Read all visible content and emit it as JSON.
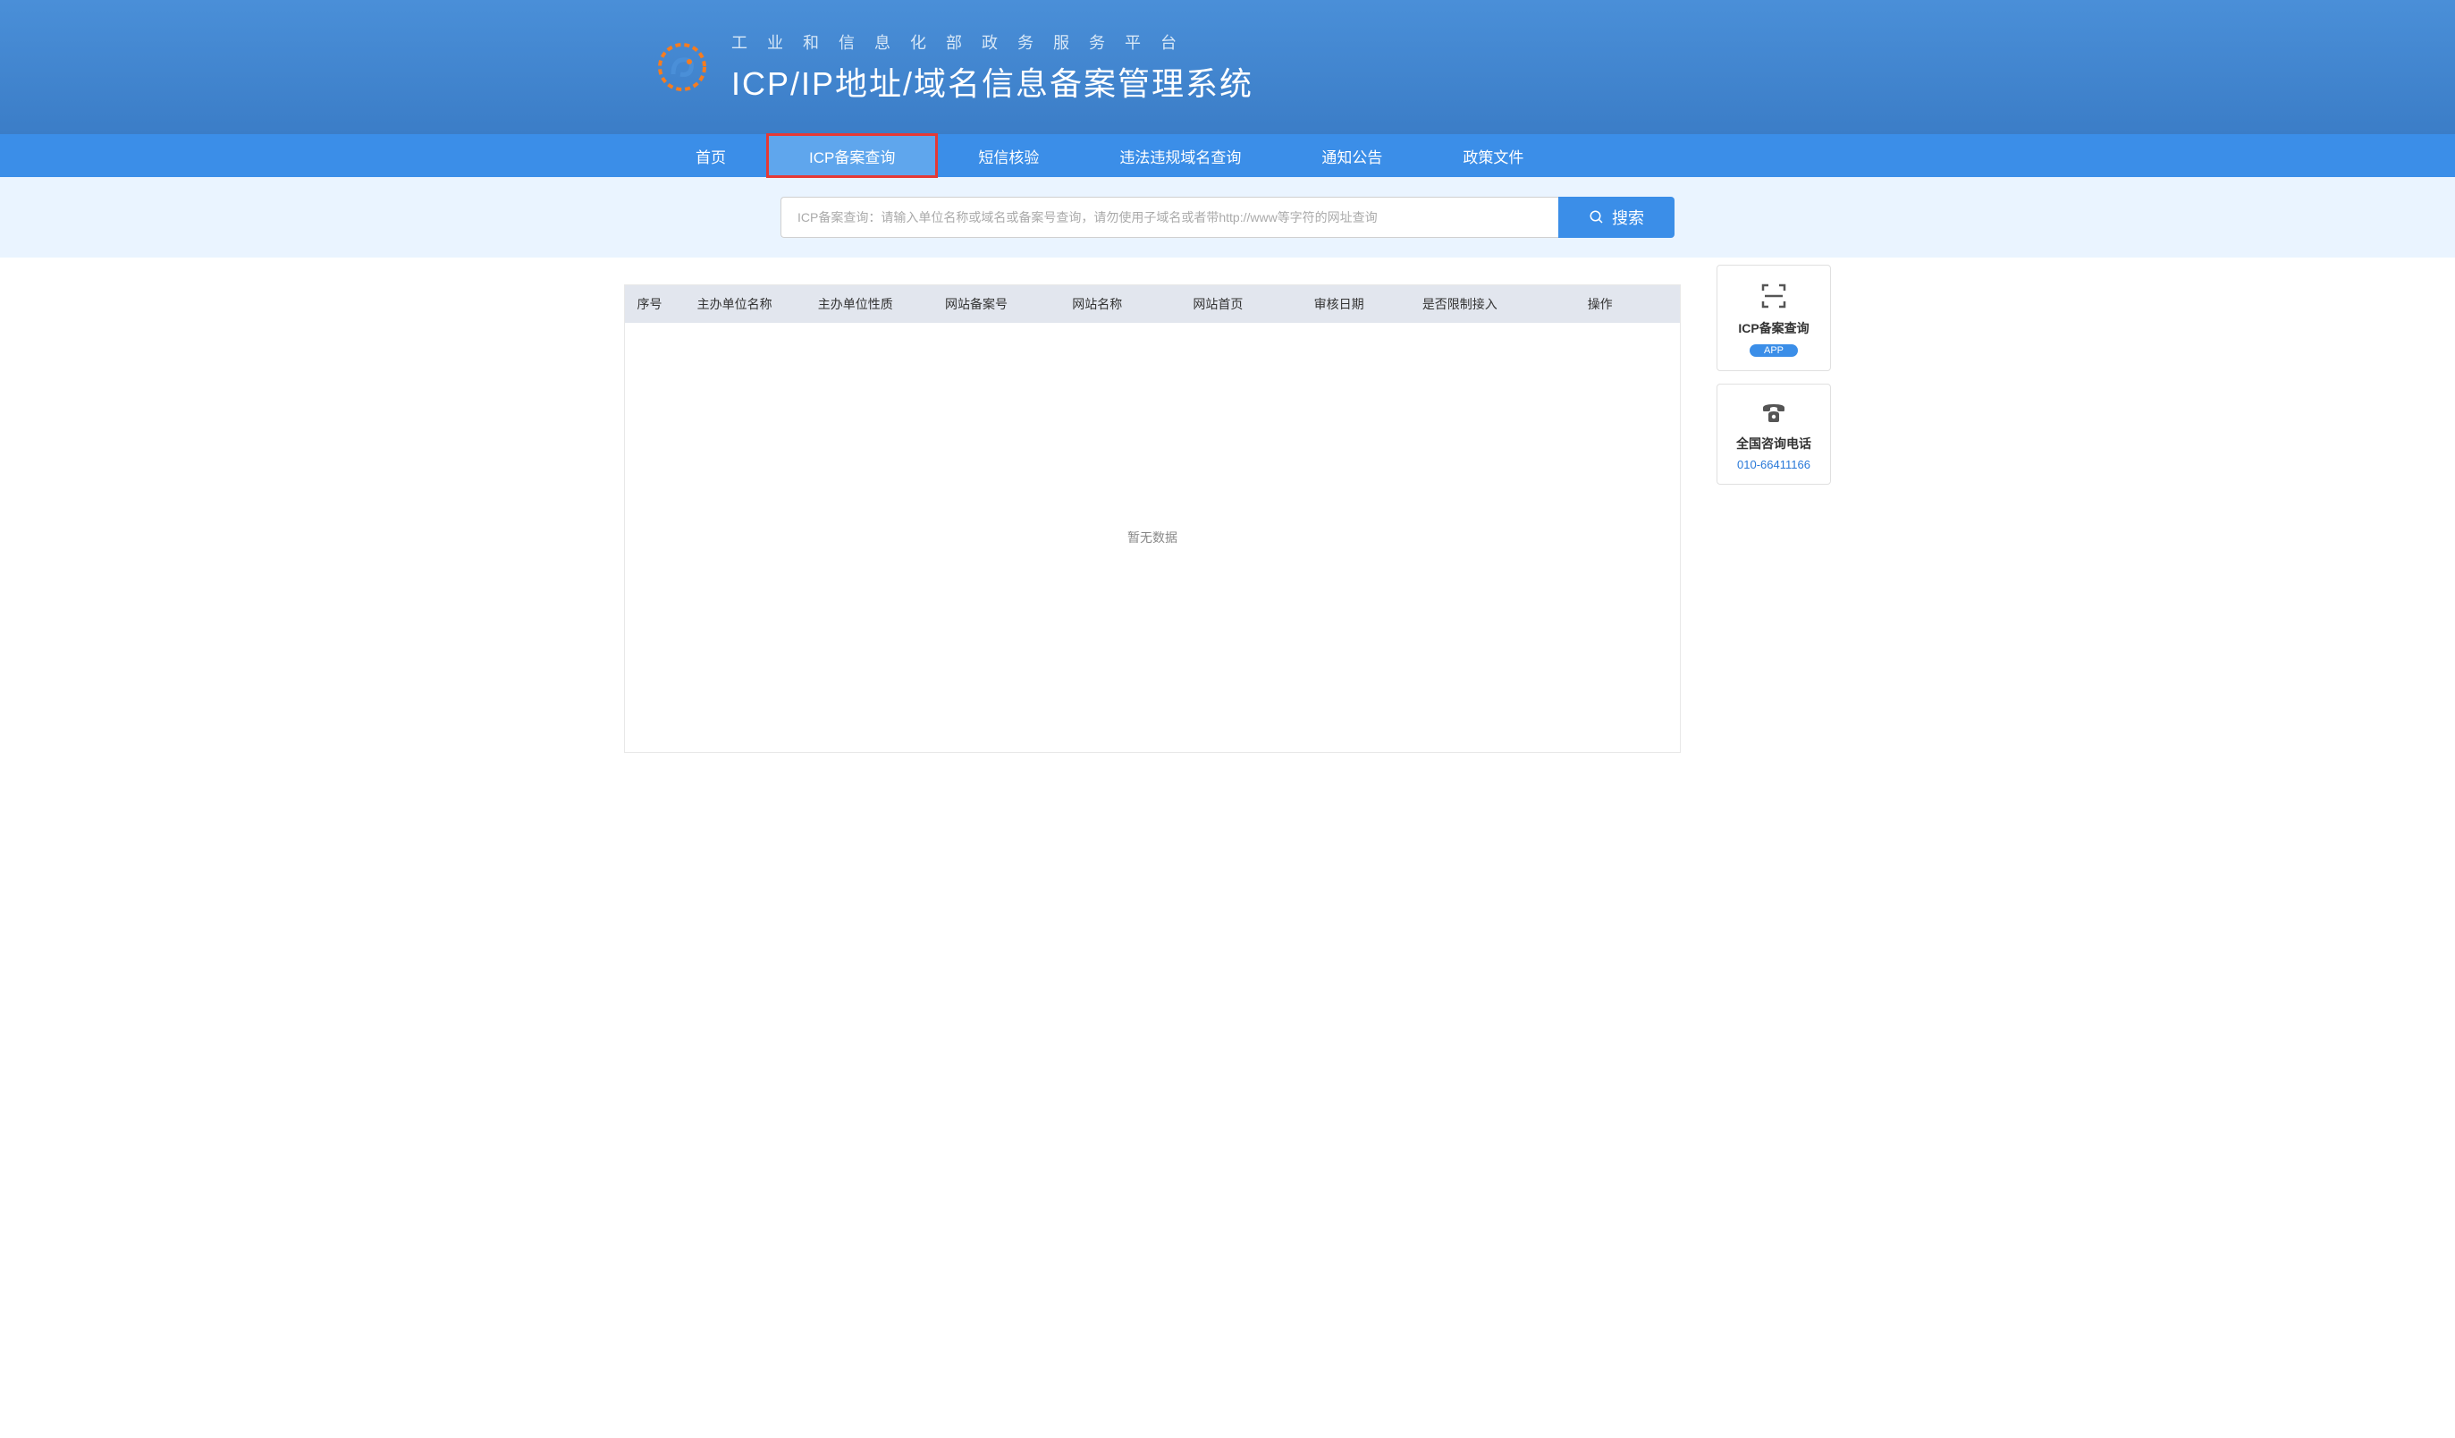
{
  "header": {
    "subtitle": "工业和信息化部政务服务平台",
    "title": "ICP/IP地址/域名信息备案管理系统"
  },
  "nav": {
    "items": [
      {
        "label": "首页"
      },
      {
        "label": "ICP备案查询"
      },
      {
        "label": "短信核验"
      },
      {
        "label": "违法违规域名查询"
      },
      {
        "label": "通知公告"
      },
      {
        "label": "政策文件"
      }
    ]
  },
  "search": {
    "placeholder": "ICP备案查询：请输入单位名称或域名或备案号查询，请勿使用子域名或者带http://www等字符的网址查询",
    "button_label": "搜索"
  },
  "table": {
    "headers": [
      "序号",
      "主办单位名称",
      "主办单位性质",
      "网站备案号",
      "网站名称",
      "网站首页",
      "审核日期",
      "是否限制接入",
      "操作"
    ],
    "empty_text": "暂无数据"
  },
  "sidebar": {
    "app": {
      "title": "ICP备案查询",
      "badge": "APP"
    },
    "phone": {
      "title": "全国咨询电话",
      "number": "010-66411166"
    }
  }
}
